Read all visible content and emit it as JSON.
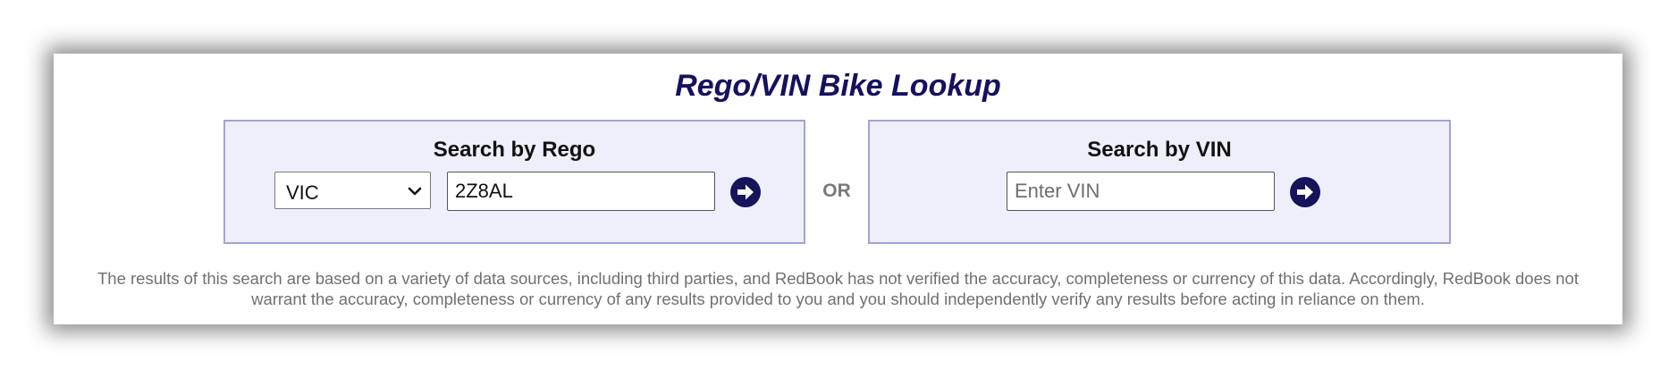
{
  "title": "Rego/VIN Bike Lookup",
  "rego_search": {
    "heading": "Search by Rego",
    "state_selected": "VIC",
    "rego_value": "2Z8AL",
    "go_icon": "arrow-right-circle-icon"
  },
  "separator": "OR",
  "vin_search": {
    "heading": "Search by VIN",
    "placeholder": "Enter VIN",
    "value": "",
    "go_icon": "arrow-right-circle-icon"
  },
  "disclaimer": "The results of this search are based on a variety of data sources, including third parties, and RedBook has not verified the accuracy, completeness or currency of this data. Accordingly, RedBook does not warrant the accuracy, completeness or currency of any results provided to you and you should independently verify any results before acting in reliance on them.",
  "colors": {
    "title": "#14125f",
    "panel_bg": "#efeffb",
    "panel_border": "#a3a3d6",
    "button": "#16145a",
    "disclaimer": "#707070"
  }
}
